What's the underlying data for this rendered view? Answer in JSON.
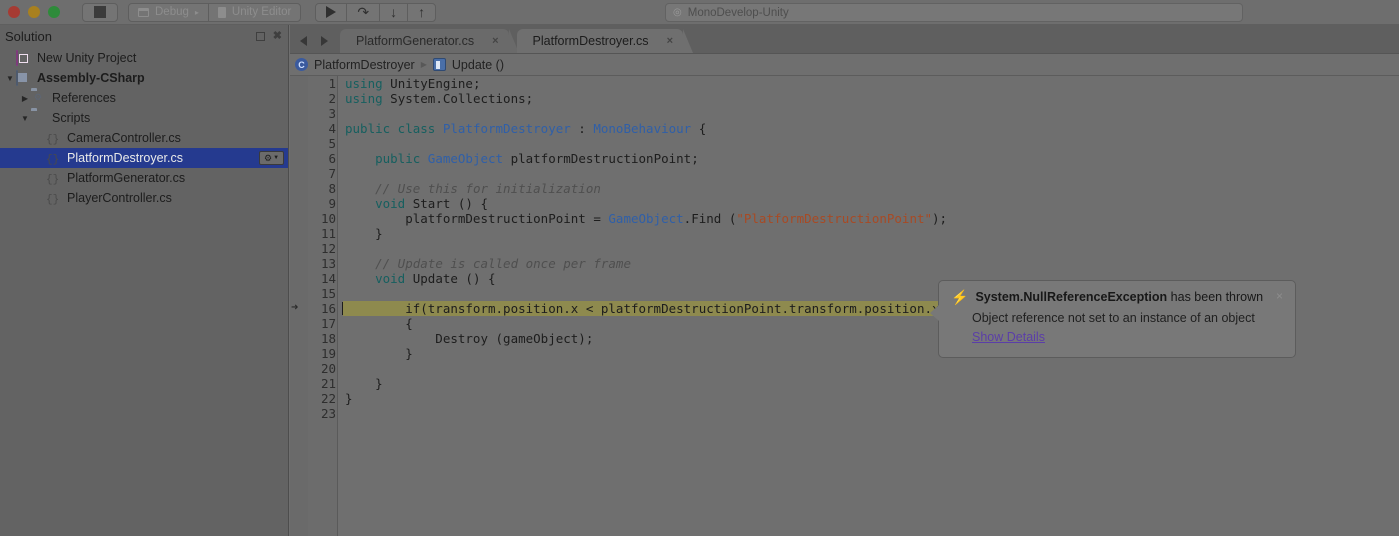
{
  "titlebar": {
    "traffic_lights": [
      "close",
      "minimize",
      "maximize"
    ],
    "stop_button_label": "",
    "target_config": "Debug",
    "target_device": "Unity Editor",
    "run_buttons": [
      "play",
      "step-over",
      "step-into",
      "step-out"
    ],
    "step_over_glyph": "↷",
    "step_into_glyph": "↓",
    "step_out_glyph": "↑",
    "search": {
      "value": "MonoDevelop-Unity",
      "icon": "◎"
    }
  },
  "sidebar": {
    "title": "Solution",
    "header_buttons": [
      "dock-icon",
      "close-icon"
    ],
    "tree": [
      {
        "label": "New Unity Project",
        "icon": "solution-icon",
        "indent": 0,
        "twisty": "",
        "bold": false,
        "selected": false
      },
      {
        "label": "Assembly-CSharp",
        "icon": "project-icon",
        "indent": 0,
        "twisty": "▼",
        "bold": true,
        "selected": false
      },
      {
        "label": "References",
        "icon": "references-icon",
        "indent": 1,
        "twisty": "▶",
        "bold": false,
        "selected": false
      },
      {
        "label": "Scripts",
        "icon": "folder-icon",
        "indent": 1,
        "twisty": "▼",
        "bold": false,
        "selected": false
      },
      {
        "label": "CameraController.cs",
        "icon": "csharp-file-icon",
        "indent": 2,
        "twisty": "",
        "bold": false,
        "selected": false
      },
      {
        "label": "PlatformDestroyer.cs",
        "icon": "csharp-file-icon",
        "indent": 2,
        "twisty": "",
        "bold": false,
        "selected": true
      },
      {
        "label": "PlatformGenerator.cs",
        "icon": "csharp-file-icon",
        "indent": 2,
        "twisty": "",
        "bold": false,
        "selected": false
      },
      {
        "label": "PlayerController.cs",
        "icon": "csharp-file-icon",
        "indent": 2,
        "twisty": "",
        "bold": false,
        "selected": false
      }
    ],
    "selected_row_gear_label": "⚙",
    "selected_row_gear_chevron": "▼"
  },
  "editor": {
    "tabs": [
      {
        "label": "PlatformGenerator.cs",
        "active": false,
        "close": "×"
      },
      {
        "label": "PlatformDestroyer.cs",
        "active": true,
        "close": "×"
      }
    ],
    "nav_back": "back-arrow",
    "nav_forward": "forward-arrow",
    "breadcrumb": {
      "class_icon_letter": "C",
      "class_name": "PlatformDestroyer",
      "separator": "▶",
      "member_name": "Update ()"
    },
    "current_line": 16,
    "cursor_line": 16,
    "lines": [
      {
        "n": 1,
        "tokens": [
          {
            "t": "k",
            "v": "using"
          },
          {
            "t": "p",
            "v": " UnityEngine;"
          }
        ]
      },
      {
        "n": 2,
        "tokens": [
          {
            "t": "k",
            "v": "using"
          },
          {
            "t": "p",
            "v": " System.Collections;"
          }
        ]
      },
      {
        "n": 3,
        "tokens": []
      },
      {
        "n": 4,
        "tokens": [
          {
            "t": "k",
            "v": "public class"
          },
          {
            "t": "p",
            "v": " "
          },
          {
            "t": "t",
            "v": "PlatformDestroyer"
          },
          {
            "t": "p",
            "v": " : "
          },
          {
            "t": "t",
            "v": "MonoBehaviour"
          },
          {
            "t": "p",
            "v": " {"
          }
        ]
      },
      {
        "n": 5,
        "tokens": []
      },
      {
        "n": 6,
        "tokens": [
          {
            "t": "p",
            "v": "    "
          },
          {
            "t": "k",
            "v": "public"
          },
          {
            "t": "p",
            "v": " "
          },
          {
            "t": "t",
            "v": "GameObject"
          },
          {
            "t": "p",
            "v": " platformDestructionPoint;"
          }
        ]
      },
      {
        "n": 7,
        "tokens": []
      },
      {
        "n": 8,
        "tokens": [
          {
            "t": "p",
            "v": "    "
          },
          {
            "t": "c",
            "v": "// Use this for initialization"
          }
        ]
      },
      {
        "n": 9,
        "tokens": [
          {
            "t": "p",
            "v": "    "
          },
          {
            "t": "k",
            "v": "void"
          },
          {
            "t": "p",
            "v": " Start () {"
          }
        ]
      },
      {
        "n": 10,
        "tokens": [
          {
            "t": "p",
            "v": "        platformDestructionPoint = "
          },
          {
            "t": "t",
            "v": "GameObject"
          },
          {
            "t": "p",
            "v": ".Find ("
          },
          {
            "t": "s",
            "v": "\"PlatformDestructionPoint\""
          },
          {
            "t": "p",
            "v": ");"
          }
        ]
      },
      {
        "n": 11,
        "tokens": [
          {
            "t": "p",
            "v": "    }"
          }
        ]
      },
      {
        "n": 12,
        "tokens": []
      },
      {
        "n": 13,
        "tokens": [
          {
            "t": "p",
            "v": "    "
          },
          {
            "t": "c",
            "v": "// Update is called once per frame"
          }
        ]
      },
      {
        "n": 14,
        "tokens": [
          {
            "t": "p",
            "v": "    "
          },
          {
            "t": "k",
            "v": "void"
          },
          {
            "t": "p",
            "v": " Update () {"
          }
        ]
      },
      {
        "n": 15,
        "tokens": []
      },
      {
        "n": 16,
        "tokens": [
          {
            "t": "p",
            "v": "        if(transform.position.x < platformDestructionPoint.transform.position.x)"
          }
        ]
      },
      {
        "n": 17,
        "tokens": [
          {
            "t": "p",
            "v": "        {"
          }
        ]
      },
      {
        "n": 18,
        "tokens": [
          {
            "t": "p",
            "v": "            Destroy (gameObject);"
          }
        ]
      },
      {
        "n": 19,
        "tokens": [
          {
            "t": "p",
            "v": "        }"
          }
        ]
      },
      {
        "n": 20,
        "tokens": []
      },
      {
        "n": 21,
        "tokens": [
          {
            "t": "p",
            "v": "    }"
          }
        ]
      },
      {
        "n": 22,
        "tokens": [
          {
            "t": "p",
            "v": "}"
          }
        ]
      },
      {
        "n": 23,
        "tokens": []
      }
    ]
  },
  "exception_popup": {
    "icon": "lightning-bolt-icon",
    "exception_name": "System.NullReferenceException",
    "title_suffix": " has been thrown",
    "message": "Object reference not set to an instance of an object",
    "details_link": "Show Details",
    "close_label": "×"
  },
  "colors": {
    "selection_blue": "#253a8f",
    "current_line_highlight": "#8e8a4e",
    "keyword": "#165f5f",
    "type": "#2f5fa8",
    "string": "#a84a24",
    "comment": "#4f4f4f",
    "link": "#5b3ea8"
  }
}
